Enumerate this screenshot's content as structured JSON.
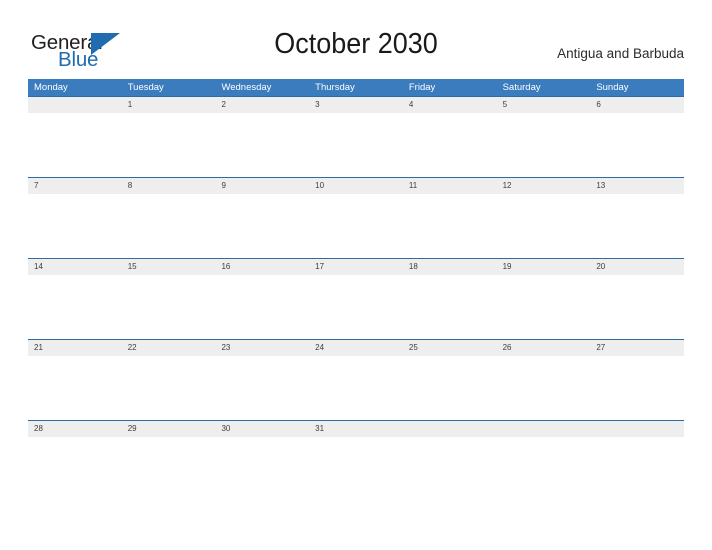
{
  "logo": {
    "word_one": "General",
    "word_two": "Blue",
    "triangle_icon": "triangle-icon",
    "primary_color": "#1f6cb0",
    "text_color": "#231f20"
  },
  "header": {
    "title": "October 2030",
    "subtitle": "Antigua and Barbuda"
  },
  "calendar": {
    "accent_color": "#3a7cbe",
    "date_band_color": "#eeeeee",
    "border_color": "#2e6da4",
    "weekdays": [
      "Monday",
      "Tuesday",
      "Wednesday",
      "Thursday",
      "Friday",
      "Saturday",
      "Sunday"
    ],
    "weeks": [
      [
        "",
        "1",
        "2",
        "3",
        "4",
        "5",
        "6"
      ],
      [
        "7",
        "8",
        "9",
        "10",
        "11",
        "12",
        "13"
      ],
      [
        "14",
        "15",
        "16",
        "17",
        "18",
        "19",
        "20"
      ],
      [
        "21",
        "22",
        "23",
        "24",
        "25",
        "26",
        "27"
      ],
      [
        "28",
        "29",
        "30",
        "31",
        "",
        "",
        ""
      ]
    ]
  }
}
